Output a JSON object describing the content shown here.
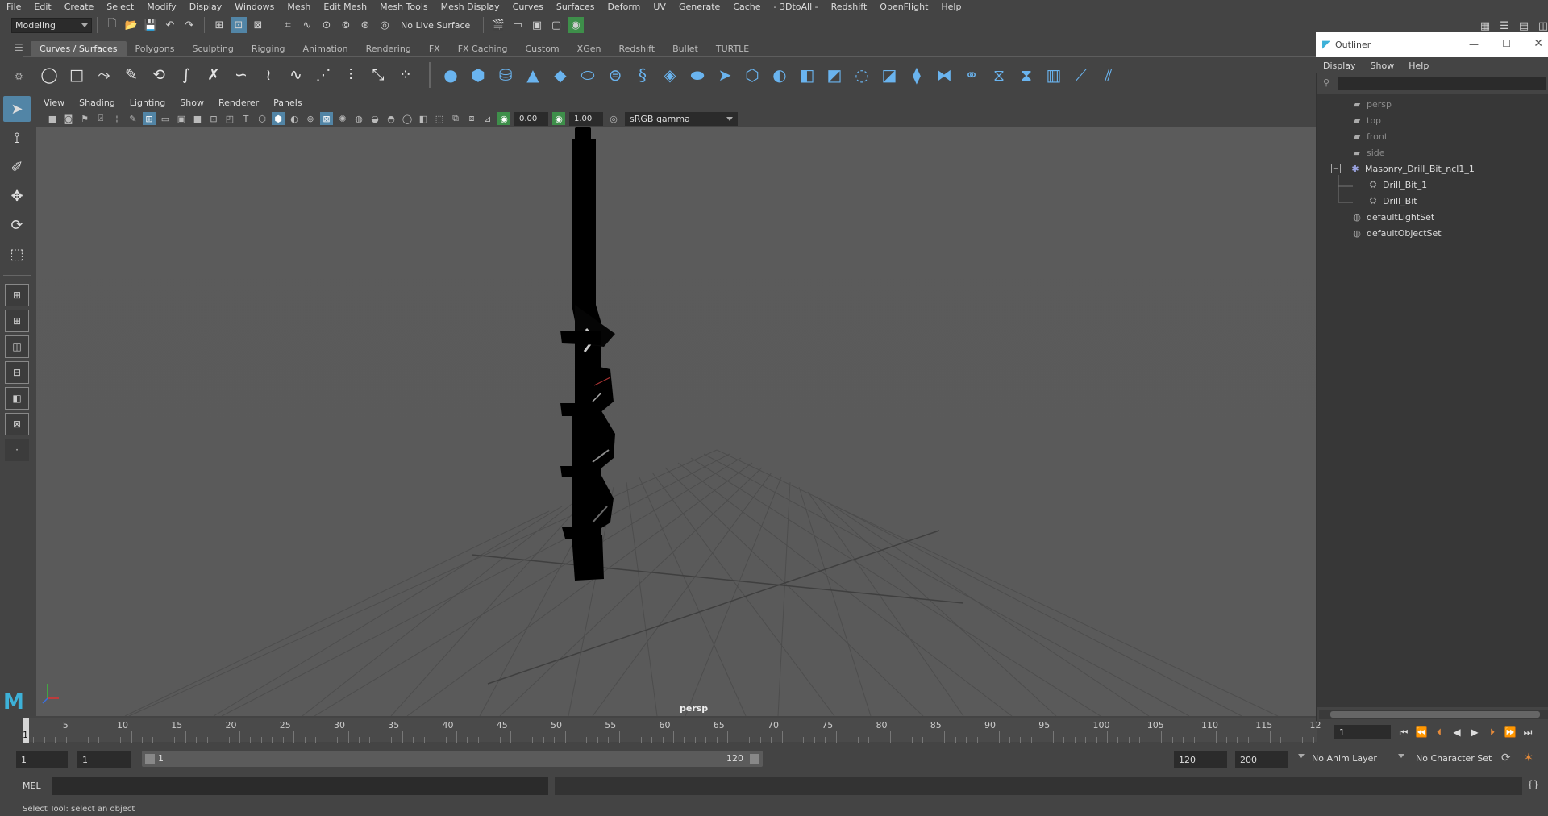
{
  "menubar": [
    "File",
    "Edit",
    "Create",
    "Select",
    "Modify",
    "Display",
    "Windows",
    "Mesh",
    "Edit Mesh",
    "Mesh Tools",
    "Mesh Display",
    "Curves",
    "Surfaces",
    "Deform",
    "UV",
    "Generate",
    "Cache",
    "- 3DtoAll -",
    "Redshift",
    "OpenFlight",
    "Help"
  ],
  "statusline": {
    "mode": "Modeling",
    "live_surface": "No Live Surface"
  },
  "shelf_tabs": [
    "Curves / Surfaces",
    "Polygons",
    "Sculpting",
    "Rigging",
    "Animation",
    "Rendering",
    "FX",
    "FX Caching",
    "Custom",
    "XGen",
    "Redshift",
    "Bullet",
    "TURTLE"
  ],
  "shelf_active": "Curves / Surfaces",
  "panel_menu": [
    "View",
    "Shading",
    "Lighting",
    "Show",
    "Renderer",
    "Panels"
  ],
  "panel_bar": {
    "exposure": "0.00",
    "gamma": "1.00",
    "color_space": "sRGB gamma"
  },
  "viewport": {
    "camera": "persp"
  },
  "timeline": {
    "ticks": [
      "5",
      "10",
      "15",
      "20",
      "25",
      "30",
      "35",
      "40",
      "45",
      "50",
      "55",
      "60",
      "65",
      "70",
      "75",
      "80",
      "85",
      "90",
      "95",
      "100",
      "105",
      "110",
      "115",
      "12"
    ],
    "current_frame_marker": "1",
    "current_frame_field": "1"
  },
  "range": {
    "start_field": "1",
    "start_field2": "1",
    "slider_start": "1",
    "slider_end": "120",
    "end_field": "120",
    "end_field2": "200",
    "anim_layer": "No Anim Layer",
    "character_set": "No Character Set"
  },
  "cmdline": {
    "label": "MEL"
  },
  "helpline": "Select Tool: select an object",
  "outliner": {
    "title": "Outliner",
    "menu": [
      "Display",
      "Show",
      "Help"
    ],
    "items": [
      {
        "label": "persp",
        "dim": true
      },
      {
        "label": "top",
        "dim": true
      },
      {
        "label": "front",
        "dim": true
      },
      {
        "label": "side",
        "dim": true
      },
      {
        "label": "Masonry_Drill_Bit_ncl1_1",
        "dim": false
      },
      {
        "label": "Drill_Bit_1",
        "dim": false
      },
      {
        "label": "Drill_Bit",
        "dim": false
      },
      {
        "label": "defaultLightSet",
        "dim": false
      },
      {
        "label": "defaultObjectSet",
        "dim": false
      }
    ]
  },
  "colors": {
    "accent": "#5285a6",
    "shelf_icon": "#6ab4ef"
  }
}
